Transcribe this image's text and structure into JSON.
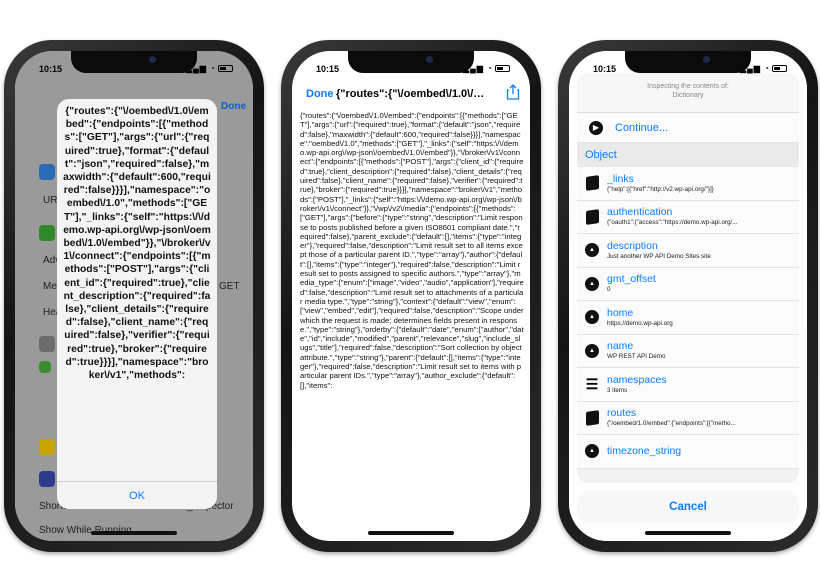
{
  "status": {
    "time": "10:15",
    "signal": "▂▄▆ ◔"
  },
  "phone1": {
    "underlay": {
      "done": "Done",
      "url_label": "URL",
      "advanced": "Adv",
      "method": "Met",
      "method_val": "GET",
      "headers": "Hea",
      "shortcut_label": "Shortcut",
      "shortcut_value": "_Inspector",
      "show_while_running": "Show While Running"
    },
    "dialog": {
      "message": "{\"routes\":{\"\\/oembed\\/1.0\\/embed\":{\"endpoints\":[{\"methods\":[\"GET\"],\"args\":{\"url\":{\"required\":true},\"format\":{\"default\":\"json\",\"required\":false},\"maxwidth\":{\"default\":600,\"required\":false}}}],\"namespace\":\"oembed\\/1.0\",\"methods\":[\"GET\"],\"_links\":{\"self\":\"https:\\/\\/demo.wp-api.org\\/wp-json\\/oembed\\/1.0\\/embed\"}},\"\\/broker\\/v1\\/connect\":{\"endpoints\":[{\"methods\":[\"POST\"],\"args\":{\"client_id\":{\"required\":true},\"client_description\":{\"required\":false},\"client_details\":{\"required\":false},\"client_name\":{\"required\":false},\"verifier\":{\"required\":true},\"broker\":{\"required\":true}}}],\"namespace\":\"broker\\/v1\",\"methods\":",
      "ok": "OK"
    }
  },
  "phone2": {
    "done": "Done",
    "title": "{\"routes\":{\"\\/oembed\\/1.0\\/e...",
    "json": "{\"routes\":{\"\\/oembed\\/1.0\\/embed\":{\"endpoints\":[{\"methods\":[\"GET\"],\"args\":{\"url\":{\"required\":true},\"format\":{\"default\":\"json\",\"required\":false},\"maxwidth\":{\"default\":600,\"required\":false}}}],\"namespace\":\"oembed\\/1.0\",\"methods\":[\"GET\"],\"_links\":{\"self\":\"https:\\/\\/demo.wp-api.org\\/wp-json\\/oembed\\/1.0\\/embed\"}},\"\\/broker\\/v1\\/connect\":{\"endpoints\":[{\"methods\":[\"POST\"],\"args\":{\"client_id\":{\"required\":true},\"client_description\":{\"required\":false},\"client_details\":{\"required\":false},\"client_name\":{\"required\":false},\"verifier\":{\"required\":true},\"broker\":{\"required\":true}}}],\"namespace\":\"broker\\/v1\",\"methods\":[\"POST\"],\"_links\":{\"self\":\"https:\\/\\/demo.wp-api.org\\/wp-json\\/broker\\/v1\\/connect\"}},\"\\/wp\\/v2\\/media\":{\"endpoints\":[{\"methods\":[\"GET\"],\"args\":{\"before\":{\"type\":\"string\",\"description\":\"Limit response to posts published before a given ISO8601 compliant date.\",\"required\":false},\"parent_exclude\":{\"default\":[],\"items\":{\"type\":\"integer\"},\"required\":false,\"description\":\"Limit result set to all items except those of a particular parent ID.\",\"type\":\"array\"},\"author\":{\"default\":[],\"items\":{\"type\":\"integer\"},\"required\":false,\"description\":\"Limit result set to posts assigned to specific authors.\",\"type\":\"array\"},\"media_type\":{\"enum\":[\"image\",\"video\",\"audio\",\"application\"],\"required\":false,\"description\":\"Limit result set to attachments of a particular media type.\",\"type\":\"string\"},\"context\":{\"default\":\"view\",\"enum\":[\"view\",\"embed\",\"edit\"],\"required\":false,\"description\":\"Scope under which the request is made; determines fields present in response.\",\"type\":\"string\"},\"orderby\":{\"default\":\"date\",\"enum\":[\"author\",\"date\",\"id\",\"include\",\"modified\",\"parent\",\"relevance\",\"slug\",\"include_slugs\",\"title\"],\"required\":false,\"description\":\"Sort collection by object attribute.\",\"type\":\"string\"},\"parent\":{\"default\":[],\"items\":{\"type\":\"integer\"},\"required\":false,\"description\":\"Limit result set to items with particular parent IDs.\",\"type\":\"array\"},\"author_exclude\":{\"default\":[],\"items\":"
  },
  "phone3": {
    "header": "Inspecting the contents of:",
    "header_sub": "Dictionary",
    "continue": "Continue...",
    "section": "Object",
    "items": [
      {
        "key": "_links",
        "value": "{\"help\":[{\"href\":\"http://v2.wp-api.org/\"}]}",
        "icon": "book-icon"
      },
      {
        "key": "authentication",
        "value": "{\"oauth1\":{\"access\":\"https://demo.wp-api.org/...",
        "icon": "book-icon"
      },
      {
        "key": "description",
        "value": "Just another WP API Demo Sites site",
        "icon": "text-icon"
      },
      {
        "key": "gmt_offset",
        "value": "0",
        "icon": "text-icon"
      },
      {
        "key": "home",
        "value": "https://demo.wp-api.org",
        "icon": "text-icon"
      },
      {
        "key": "name",
        "value": "WP REST API Demo",
        "icon": "text-icon"
      },
      {
        "key": "namespaces",
        "value": "3 items",
        "icon": "list-icon"
      },
      {
        "key": "routes",
        "value": "{\"/oembed/1.0/embed\":{\"endpoints\":[{\"metho...",
        "icon": "book-icon"
      },
      {
        "key": "timezone_string",
        "value": "",
        "icon": "text-icon"
      }
    ],
    "cancel": "Cancel"
  }
}
